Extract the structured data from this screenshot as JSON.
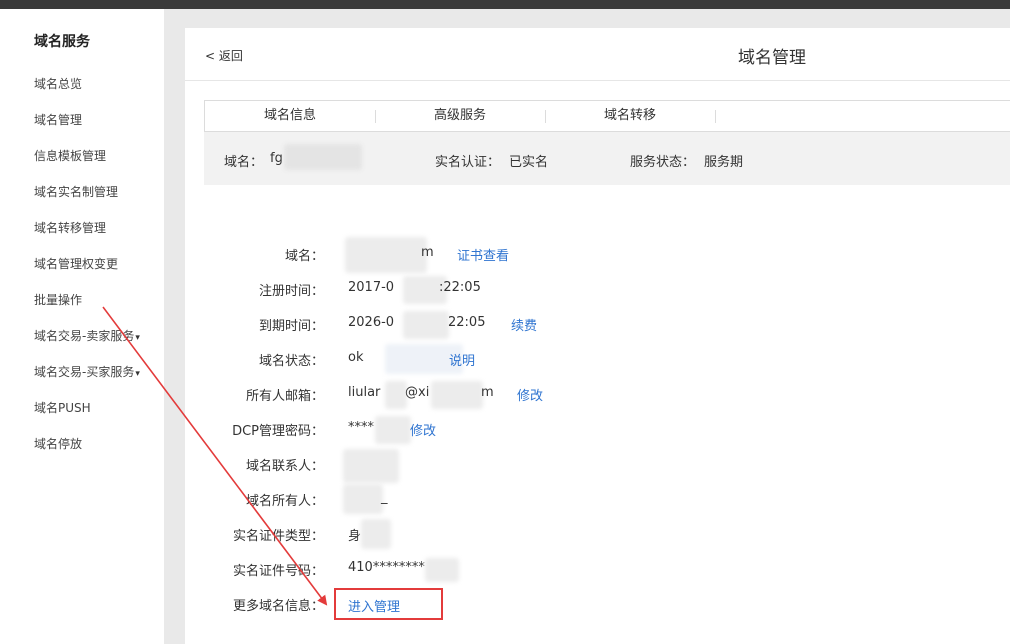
{
  "sidebar": {
    "title": "域名服务",
    "items": [
      {
        "label": "域名总览"
      },
      {
        "label": "域名管理"
      },
      {
        "label": "信息模板管理"
      },
      {
        "label": "域名实名制管理"
      },
      {
        "label": "域名转移管理"
      },
      {
        "label": "域名管理权变更"
      },
      {
        "label": "批量操作"
      },
      {
        "label": "域名交易-卖家服务",
        "caret": "▾"
      },
      {
        "label": "域名交易-买家服务",
        "caret": "▾"
      },
      {
        "label": "域名PUSH"
      },
      {
        "label": "域名停放"
      }
    ]
  },
  "header": {
    "back_label": "< 返回",
    "title": "域名管理"
  },
  "tabs": [
    {
      "label": "域名信息"
    },
    {
      "label": "高级服务"
    },
    {
      "label": "域名转移"
    }
  ],
  "summary": {
    "domain_label": "域名：",
    "domain_value": "fg",
    "realname_label": "实名认证：",
    "realname_value": "已实名",
    "status_label": "服务状态：",
    "status_value": "服务期"
  },
  "details": {
    "domain": {
      "label": "域名：",
      "value": "m",
      "action": "证书查看"
    },
    "reg_time": {
      "label": "注册时间：",
      "value_a": "2017-0",
      "value_b": ":22:05"
    },
    "exp_time": {
      "label": "到期时间：",
      "value_a": "2026-0",
      "value_b": "22:05",
      "action": "续费"
    },
    "status": {
      "label": "域名状态：",
      "value": "ok",
      "action": "说明"
    },
    "email": {
      "label": "所有人邮箱：",
      "value_a": "liular",
      "value_b": "@xi",
      "value_c": "m",
      "action": "修改"
    },
    "dcp": {
      "label": "DCP管理密码：",
      "value": "****",
      "action": "修改"
    },
    "contact": {
      "label": "域名联系人："
    },
    "owner": {
      "label": "域名所有人：",
      "value": "_"
    },
    "id_type": {
      "label": "实名证件类型：",
      "value": "身"
    },
    "id_number": {
      "label": "实名证件号码：",
      "value": "410********"
    },
    "more": {
      "label": "更多域名信息：",
      "action": "进入管理"
    }
  },
  "colors": {
    "link": "#2f74d0",
    "highlight": "#e33b3b",
    "topbar": "#3a3a3a"
  }
}
